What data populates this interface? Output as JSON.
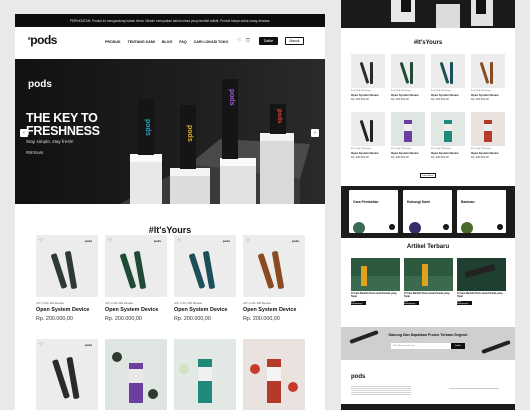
{
  "announcement": "PERINGATAN: Produk ini mengandung bahan kimia. Nikotin merupakan bahan kimia yang bersifat adiktif. Produk hanya untuk orang dewasa.",
  "brand": {
    "name": "pods",
    "prefix": "e"
  },
  "nav": {
    "items": [
      "PRODUK",
      "TENTANG KAMI",
      "BLOG",
      "FAQ",
      "CARI LOKASI TOKO"
    ],
    "daftar": "Daftar",
    "masuk": "Masuk"
  },
  "hero": {
    "logo": "pods",
    "title_line1": "THE KEY TO",
    "title_line2": "FRESHNESS",
    "subtitle": "Stay simple, stay fresh!",
    "hashtag": "#ItsYours"
  },
  "section_title": "#It'sYours",
  "products": [
    {
      "rating": "4.8 | 2,4rb 129 Review",
      "name": "Open System Device",
      "price": "Rp. 200.000,00",
      "color": "#2f3a36"
    },
    {
      "rating": "4.8 | 2,4rb 129 Review",
      "name": "Open System Device",
      "price": "Rp. 200.000,00",
      "color": "#1f4b36"
    },
    {
      "rating": "4.8 | 2,4rb 129 Review",
      "name": "Open System Device",
      "price": "Rp. 200.000,00",
      "color": "#1d4f5a"
    },
    {
      "rating": "4.8 | 2,4rb 129 Review",
      "name": "Open System Device",
      "price": "Rp. 200.000,00",
      "color": "#8a4a22"
    }
  ],
  "right": {
    "section_title": "#It'sYours",
    "product_name": "Open System Device",
    "price": "Rp. 200.000,00",
    "rating": "4.8 | 2,4rb 129 Review",
    "more_btn": "Lihat Semua",
    "info": [
      {
        "title": "Cara Pembelian",
        "color": "#3a6a56"
      },
      {
        "title": "Hubungi Kami",
        "color": "#3b2d6a"
      },
      {
        "title": "Bantuan",
        "color": "#4a6a2a"
      }
    ],
    "articles_title": "Artikel Terbaru",
    "article_caption": "10 Cara Memilih Pods untuk Pemula yang Tepat",
    "article_btn": "Baca Selengkapnya",
    "promo_title": "Gabung Dan Dapatkan Promo Terbaru Segera!",
    "promo_placeholder": "Masukkan email kamu",
    "promo_btn": "Daftar",
    "footer_brand": "pods"
  }
}
